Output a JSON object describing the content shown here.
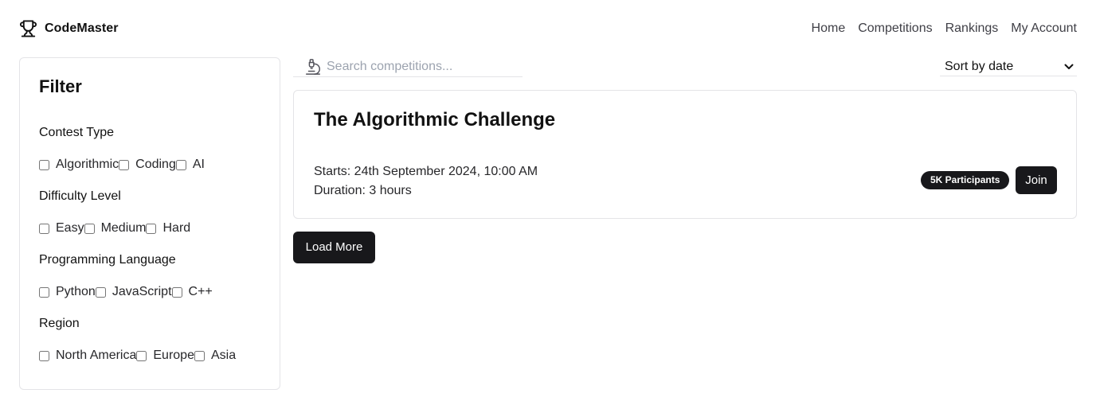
{
  "brand": {
    "name": "CodeMaster",
    "icon": "trophy-icon"
  },
  "nav": {
    "items": [
      {
        "label": "Home"
      },
      {
        "label": "Competitions"
      },
      {
        "label": "Rankings"
      },
      {
        "label": "My Account"
      }
    ]
  },
  "filter": {
    "title": "Filter",
    "groups": [
      {
        "title": "Contest Type",
        "options": [
          "Algorithmic",
          "Coding",
          "AI"
        ]
      },
      {
        "title": "Difficulty Level",
        "options": [
          "Easy",
          "Medium",
          "Hard"
        ]
      },
      {
        "title": "Programming Language",
        "options": [
          "Python",
          "JavaScript",
          "C++"
        ]
      },
      {
        "title": "Region",
        "options": [
          "North America",
          "Europe",
          "Asia"
        ]
      }
    ]
  },
  "search": {
    "placeholder": "Search competitions...",
    "value": "",
    "icon": "microscope-icon"
  },
  "sort": {
    "selected": "Sort by date"
  },
  "competitions": [
    {
      "title": "The Algorithmic Challenge",
      "starts": "Starts: 24th September 2024, 10:00 AM",
      "duration": "Duration: 3 hours",
      "participants": "5K Participants",
      "join_label": "Join"
    }
  ],
  "load_more_label": "Load More",
  "colors": {
    "primary": "#18181b",
    "border": "#e4e4e7",
    "muted_text": "#9ca3af"
  }
}
